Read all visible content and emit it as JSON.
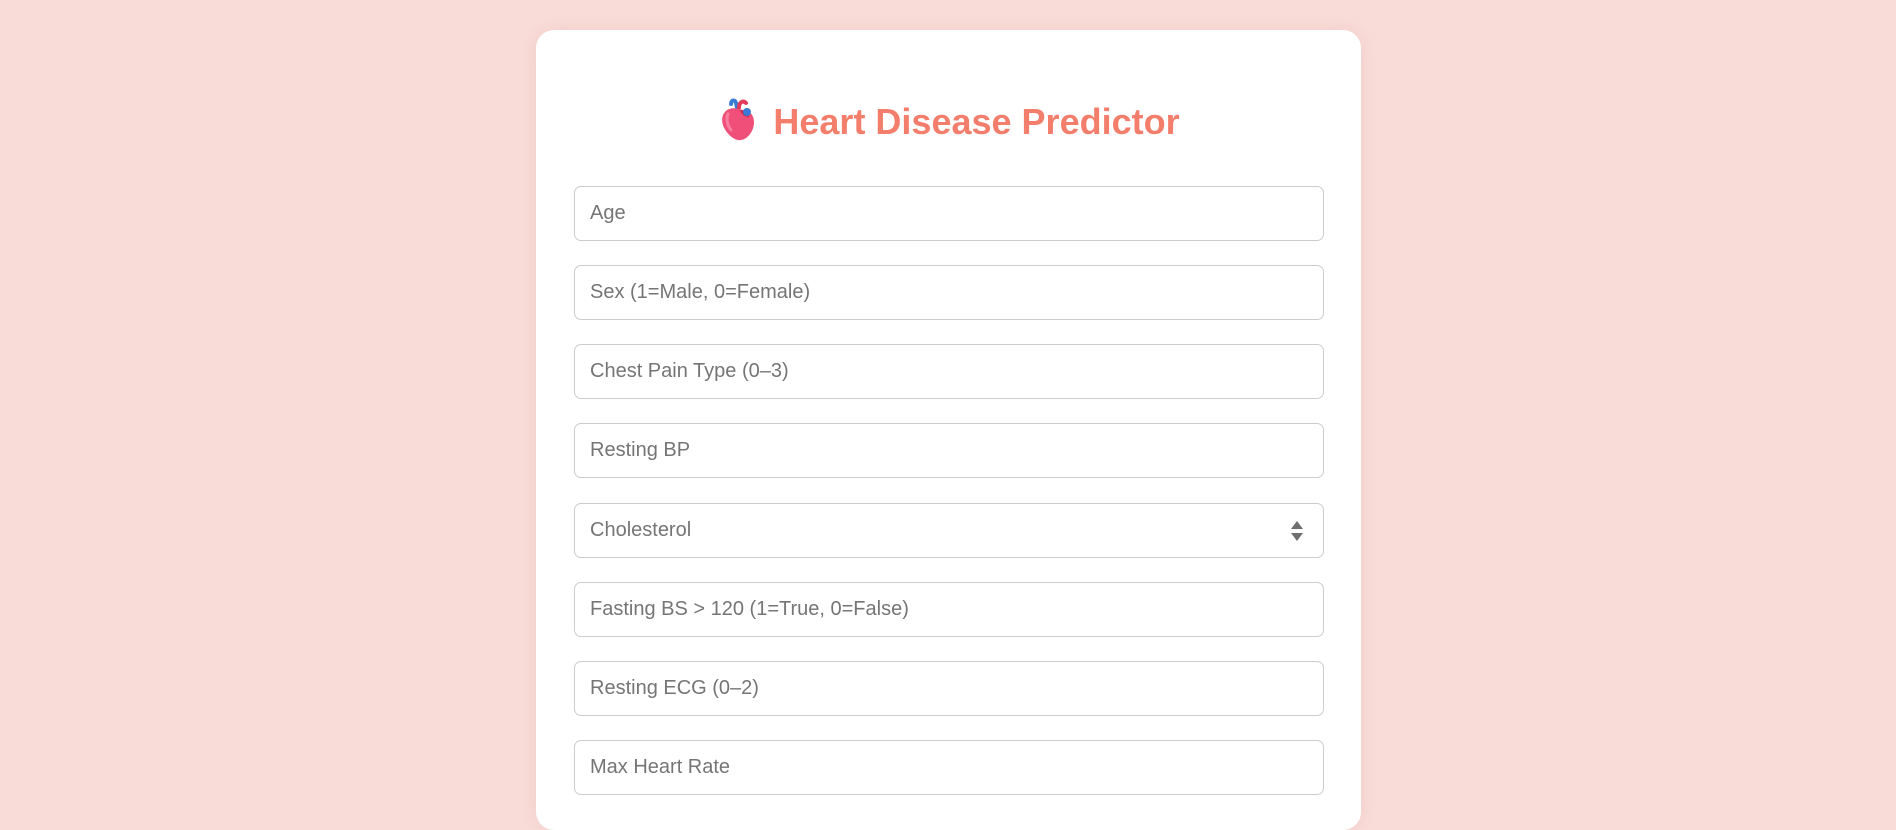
{
  "header": {
    "title": "Heart Disease Predictor",
    "icon": "anatomical-heart-icon"
  },
  "form": {
    "fields": [
      {
        "placeholder": "Age",
        "value": ""
      },
      {
        "placeholder": "Sex (1=Male, 0=Female)",
        "value": ""
      },
      {
        "placeholder": "Chest Pain Type (0–3)",
        "value": ""
      },
      {
        "placeholder": "Resting BP",
        "value": ""
      },
      {
        "placeholder": "Cholesterol",
        "value": "",
        "has_spinner": true
      },
      {
        "placeholder": "Fasting BS > 120 (1=True, 0=False)",
        "value": ""
      },
      {
        "placeholder": "Resting ECG (0–2)",
        "value": ""
      },
      {
        "placeholder": "Max Heart Rate",
        "value": ""
      }
    ]
  },
  "colors": {
    "page_background": "#f9dcd8",
    "card_background": "#ffffff",
    "title": "#f47e6c",
    "field_border": "#cccccc",
    "placeholder": "#757575"
  }
}
